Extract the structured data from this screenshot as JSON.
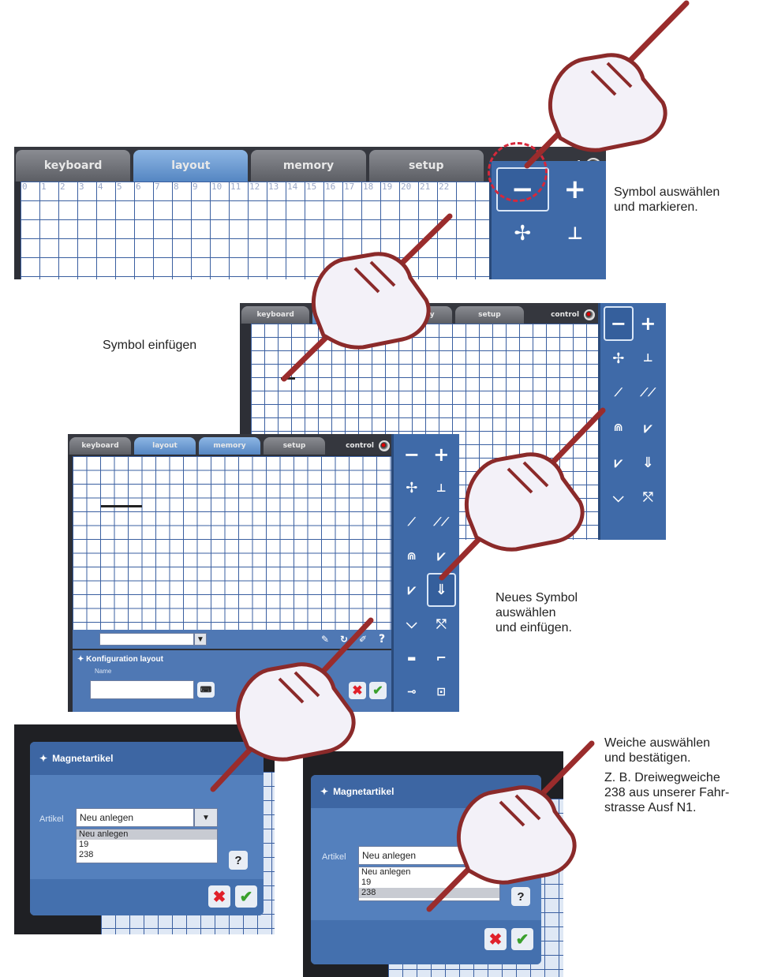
{
  "tabs": {
    "keyboard": "keyboard",
    "layout": "layout",
    "memory": "memory",
    "setup": "setup",
    "control": "control"
  },
  "grid_numbers": [
    "0",
    "1",
    "2",
    "3",
    "4",
    "5",
    "6",
    "7",
    "8",
    "9",
    "10",
    "11",
    "12",
    "13",
    "14",
    "15",
    "16",
    "17",
    "18",
    "19",
    "20",
    "21",
    "22"
  ],
  "palette_symbols": [
    "−",
    "+",
    "✢",
    "⊥",
    "⟋",
    "⟋⟋",
    "⋒",
    "⩗",
    "⩗",
    "⇓",
    "⌵",
    "⤲",
    "▬",
    "⌐",
    "⊸",
    "⊡"
  ],
  "captions": {
    "step1": "Symbol auswählen\nund markieren.",
    "step2": "Symbol einfügen",
    "step3": "Neues Symbol\nauswählen\nund einfügen.",
    "step4a": "Weiche auswählen\nund bestätigen.",
    "step4b": "Z. B. Dreiwegweiche\n238 aus unserer Fahr-\nstrasse Ausf N1."
  },
  "config_panel": {
    "title": "Konfiguration layout",
    "name_label": "Name"
  },
  "dialog": {
    "title": "Magnetartikel",
    "field_label": "Artikel",
    "selected": "Neu anlegen",
    "options": [
      "Neu anlegen",
      "19",
      "238"
    ],
    "help": "?",
    "cancel": "✖",
    "ok": "✔"
  },
  "colors": {
    "accent_blue": "#5480bd",
    "hand_outline": "#8b2a2a",
    "selection_ring": "#d6283b"
  }
}
